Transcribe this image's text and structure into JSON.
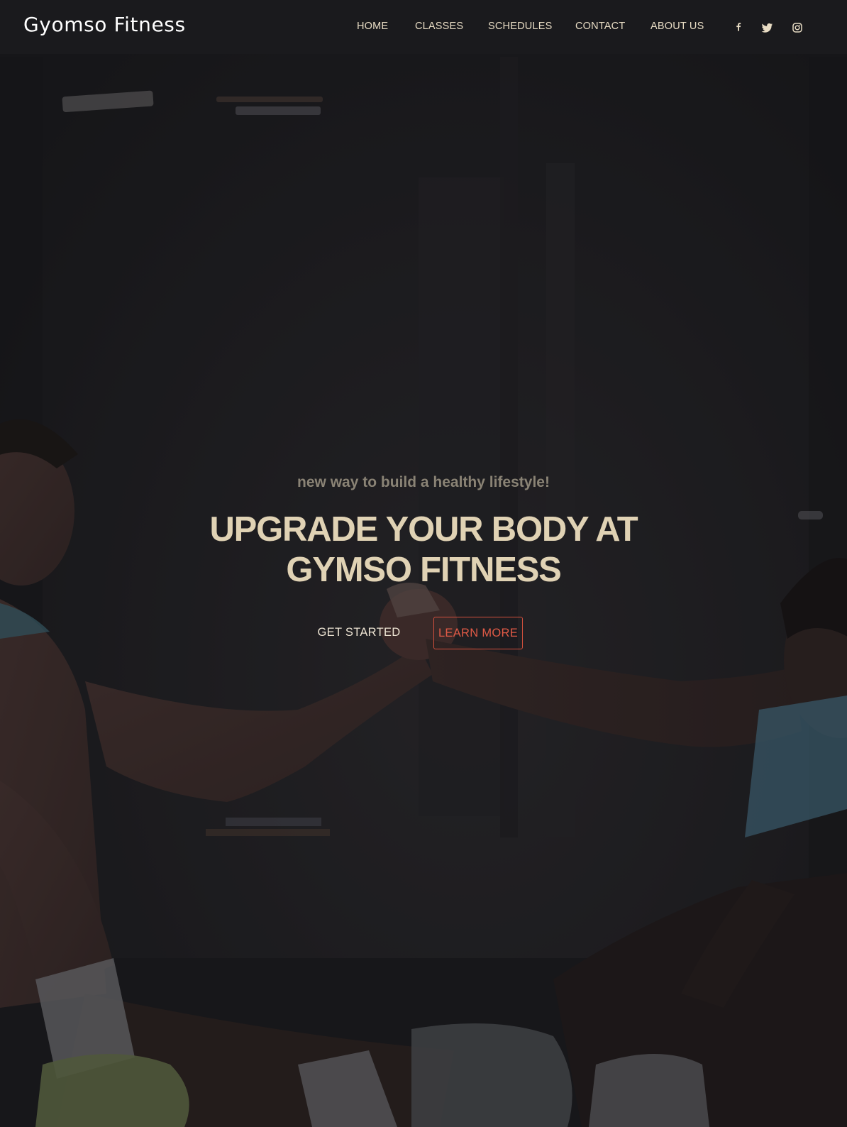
{
  "site": {
    "brand": "Gyomso Fitness"
  },
  "nav": {
    "items": [
      {
        "label": "HOME"
      },
      {
        "label": "CLASSES"
      },
      {
        "label": "SCHEDULES"
      },
      {
        "label": "CONTACT"
      },
      {
        "label": "ABOUT US"
      }
    ],
    "social": [
      {
        "icon": "facebook-icon"
      },
      {
        "icon": "twitter-icon"
      },
      {
        "icon": "instagram-icon"
      }
    ]
  },
  "hero": {
    "tagline": "new way to build a healthy lifestyle!",
    "headline_line1": "UPGRADE YOUR BODY AT",
    "headline_line2": "GYMSO FITNESS",
    "primary_button": "GET STARTED",
    "secondary_button": "LEARN MORE"
  },
  "colors": {
    "background": "#1b1b1e",
    "headline": "#e0d2b4",
    "nav_text": "#e8dcc4",
    "accent": "#e05a46",
    "tagline": "#8a8375"
  }
}
